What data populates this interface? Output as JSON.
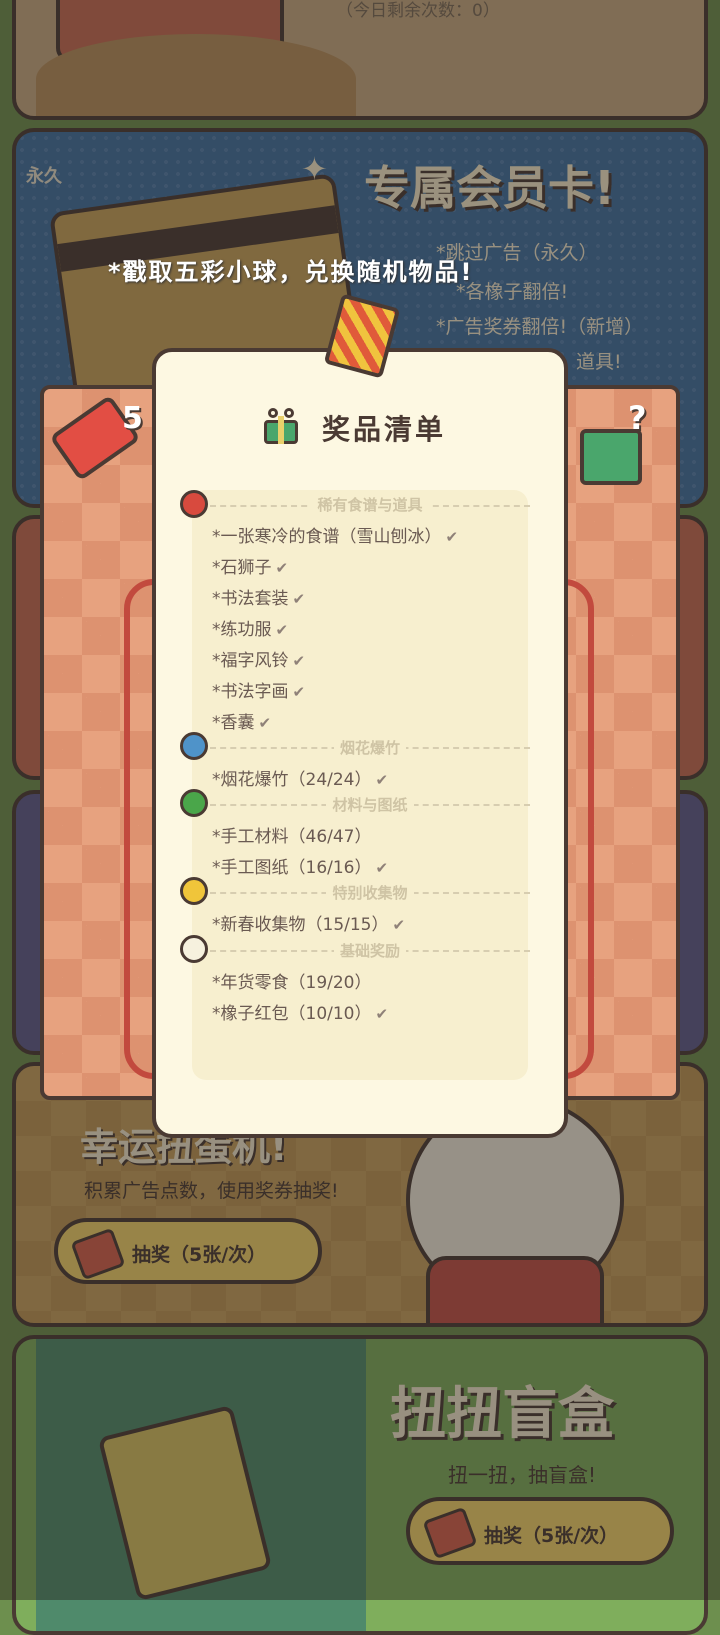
{
  "top_card": {
    "remaining_text": "（今日剩余次数：0）"
  },
  "member_card": {
    "title": "专属会员卡!",
    "tag": "永久",
    "benefits": [
      "*跳过广告（永久）",
      "*各橡子翻倍!",
      "*广告奖券翻倍!（新增）",
      "道具!"
    ]
  },
  "hint": "*戳取五彩小球，兑换随机物品!",
  "gacha": {
    "ticket_count": "5"
  },
  "prize_list": {
    "title": "奖品清单",
    "sections": [
      {
        "name": "稀有食谱与道具",
        "ball_color": "#d84a3e",
        "items": [
          "*一张寒冷的食谱（雪山刨冰）",
          "*石狮子",
          "*书法套装",
          "*练功服",
          "*福字风铃",
          "*书法字画",
          "*香囊"
        ]
      },
      {
        "name": "烟花爆竹",
        "ball_color": "#4f93c9",
        "items": [
          "*烟花爆竹（24/24）"
        ]
      },
      {
        "name": "材料与图纸",
        "ball_color": "#4aa64a",
        "items": [
          "*手工材料（46/47）",
          "*手工图纸（16/16）"
        ]
      },
      {
        "name": "特别收集物",
        "ball_color": "#f0c53a",
        "items": [
          "*新春收集物（15/15）"
        ]
      },
      {
        "name": "基础奖励",
        "ball_color": "#f6f1de",
        "items": [
          "*年货零食（19/20）",
          "*橡子红包（10/10）"
        ]
      }
    ]
  },
  "lucky_machine": {
    "title": "幸运扭蛋机!",
    "subtitle": "积累广告点数，使用奖券抽奖!",
    "button": "抽奖（5张/次）"
  },
  "blind_box": {
    "title": "扭扭盲盒",
    "subtitle": "扭一扭，抽盲盒!",
    "button": "抽奖（5张/次）"
  }
}
